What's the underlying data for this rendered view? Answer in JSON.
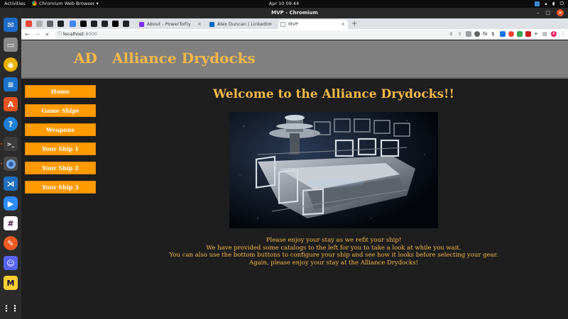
{
  "system_bar": {
    "activities": "Activities",
    "app_name": "Chromium Web Browser ▾",
    "clock": "Apr 10  09:44"
  },
  "dock": {
    "items": [
      "thunderbird",
      "files",
      "rhythmbox",
      "libreoffice-writer",
      "ubuntu-software",
      "help",
      "terminal",
      "chromium",
      "vscode",
      "zoom",
      "slack",
      "postman",
      "discord",
      "miro",
      "show-apps"
    ]
  },
  "window": {
    "title": "MVP - Chromium"
  },
  "tabs": [
    {
      "label": "About - PowerToFly",
      "favicon_color": "#7b2ff7"
    },
    {
      "label": "Alex Duncan | LinkedIn",
      "favicon_color": "#0a66c2"
    },
    {
      "label": "MVP",
      "favicon_color": "#5f6368",
      "active": true
    }
  ],
  "toolbar": {
    "url_host": "localhost",
    "url_port": ":8000"
  },
  "site": {
    "logo": "AD",
    "title": "Alliance Drydocks",
    "nav": [
      "Home",
      "Game Ships",
      "Weapons",
      "Your Ship 1",
      "Your Ship 2",
      "Your Ship 3"
    ],
    "welcome": "Welcome to the Alliance Drydocks!!",
    "intro": [
      "Please enjoy your stay as we refit your ship!",
      "We have provided some catalogs to the left for you to take a look at while you wait.",
      "You can also use the bottom buttons to configure your ship and see how it looks before selecting your gear.",
      "Again, please enjoy your stay at the Alliance Drydocks!"
    ]
  },
  "colors": {
    "accent_gold": "#f5b94a",
    "nav_orange": "#ff9a00",
    "header_gray": "#808080",
    "page_bg": "#1e1e1e"
  }
}
